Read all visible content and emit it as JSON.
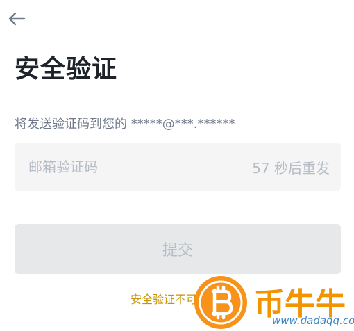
{
  "header": {
    "back_icon": "arrow-left-icon"
  },
  "page": {
    "title": "安全验证",
    "subtitle": "将发送验证码到您的 *****@***.******"
  },
  "code_field": {
    "placeholder": "邮箱验证码",
    "value": "",
    "resend_label": "57 秒后重发"
  },
  "submit": {
    "label": "提交",
    "state": "disabled"
  },
  "footer": {
    "link_label": "安全验证不可用?"
  },
  "watermark": {
    "logo_icon": "bitcoin-logo-icon",
    "text": "币牛牛",
    "url": "www.dadaqq.com"
  },
  "colors": {
    "title": "#1e2329",
    "subtitle": "#707a8a",
    "field_bg": "#f5f5f5",
    "placeholder": "#b7bdc6",
    "button_disabled_bg": "#e6e8ea",
    "link_accent": "#c99400",
    "watermark_orange": "#f29300"
  }
}
